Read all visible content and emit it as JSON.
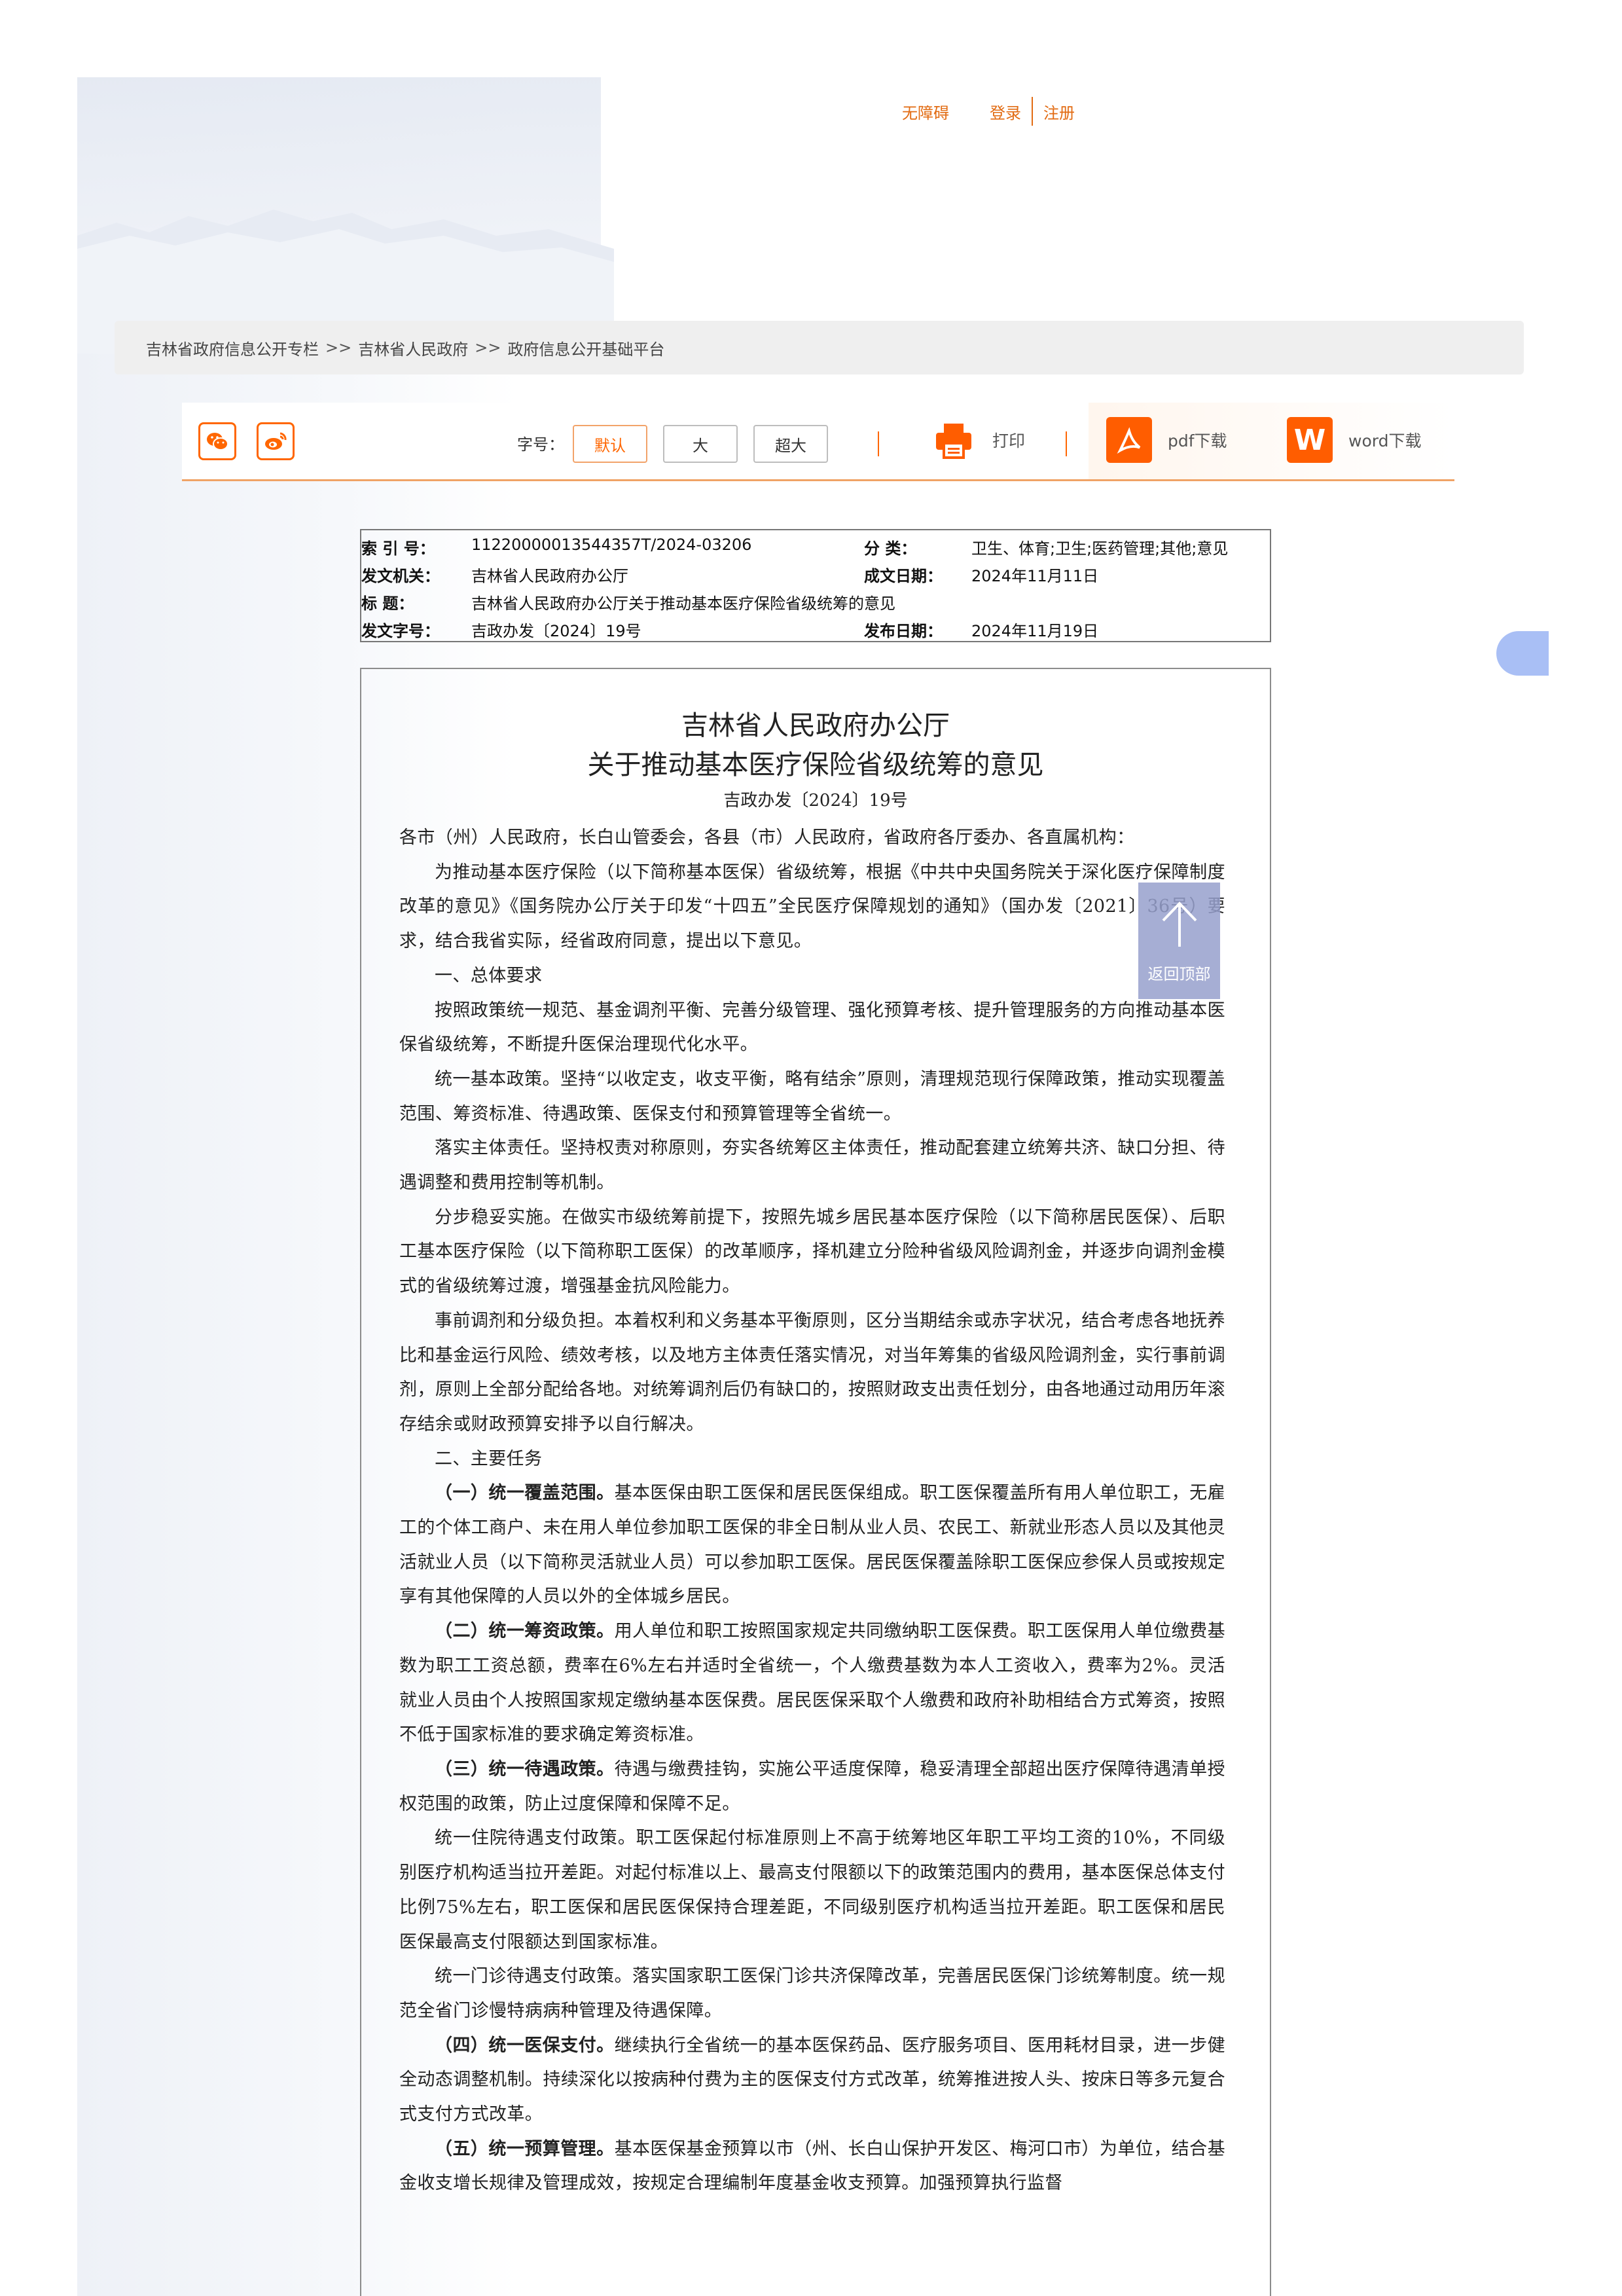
{
  "top_links": {
    "accessibility": "无障碍",
    "login": "登录",
    "register": "注册"
  },
  "breadcrumb": {
    "items": [
      "吉林省政府信息公开专栏",
      "吉林省人民政府",
      "政府信息公开基础平台"
    ],
    "separator": ">>"
  },
  "toolbar": {
    "share_icons": [
      "wechat-icon",
      "weibo-icon"
    ],
    "font_size_label": "字号：",
    "font_sizes": [
      "默认",
      "大",
      "超大"
    ],
    "print_label": "打印",
    "pdf_label": "pdf下载",
    "word_label": "word下载"
  },
  "meta": {
    "index_key": "索 引 号：",
    "index_val": "11220000013544357T/2024-03206",
    "category_key": "分    类：",
    "category_val": "卫生、体育;卫生;医药管理;其他;意见",
    "issuer_key": "发文机关：",
    "issuer_val": "吉林省人民政府办公厅",
    "created_key": "成文日期：",
    "created_val": "2024年11月11日",
    "title_key": "标    题：",
    "title_val": "吉林省人民政府办公厅关于推动基本医疗保险省级统筹的意见",
    "docno_key": "发文字号：",
    "docno_val": "吉政办发〔2024〕19号",
    "published_key": "发布日期：",
    "published_val": "2024年11月19日"
  },
  "document": {
    "title_line1": "吉林省人民政府办公厅",
    "title_line2": "关于推动基本医疗保险省级统筹的意见",
    "doc_no": "吉政办发〔2024〕19号",
    "salutation": "各市（州）人民政府，长白山管委会，各县（市）人民政府，省政府各厅委办、各直属机构：",
    "p1": "为推动基本医疗保险（以下简称基本医保）省级统筹，根据《中共中央国务院关于深化医疗保障制度改革的意见》《国务院办公厅关于印发“十四五”全民医疗保障规划的通知》（国办发〔2021〕36号）要求，结合我省实际，经省政府同意，提出以下意见。",
    "h1": "一、总体要求",
    "p2": "按照政策统一规范、基金调剂平衡、完善分级管理、强化预算考核、提升管理服务的方向推动基本医保省级统筹，不断提升医保治理现代化水平。",
    "p3": "统一基本政策。坚持“以收定支，收支平衡，略有结余”原则，清理规范现行保障政策，推动实现覆盖范围、筹资标准、待遇政策、医保支付和预算管理等全省统一。",
    "p4": "落实主体责任。坚持权责对称原则，夯实各统筹区主体责任，推动配套建立统筹共济、缺口分担、待遇调整和费用控制等机制。",
    "p5": "分步稳妥实施。在做实市级统筹前提下，按照先城乡居民基本医疗保险（以下简称居民医保）、后职工基本医疗保险（以下简称职工医保）的改革顺序，择机建立分险种省级风险调剂金，并逐步向调剂金模式的省级统筹过渡，增强基金抗风险能力。",
    "p6": "事前调剂和分级负担。本着权利和义务基本平衡原则，区分当期结余或赤字状况，结合考虑各地抚养比和基金运行风险、绩效考核，以及地方主体责任落实情况，对当年筹集的省级风险调剂金，实行事前调剂，原则上全部分配给各地。对统筹调剂后仍有缺口的，按照财政支出责任划分，由各地通过动用历年滚存结余或财政预算安排予以自行解决。",
    "h2": "二、主要任务",
    "s1_title": "（一）统一覆盖范围。",
    "s1": "基本医保由职工医保和居民医保组成。职工医保覆盖所有用人单位职工，无雇工的个体工商户、未在用人单位参加职工医保的非全日制从业人员、农民工、新就业形态人员以及其他灵活就业人员（以下简称灵活就业人员）可以参加职工医保。居民医保覆盖除职工医保应参保人员或按规定享有其他保障的人员以外的全体城乡居民。",
    "s2_title": "（二）统一筹资政策。",
    "s2": "用人单位和职工按照国家规定共同缴纳职工医保费。职工医保用人单位缴费基数为职工工资总额，费率在6%左右并适时全省统一，个人缴费基数为本人工资收入，费率为2%。灵活就业人员由个人按照国家规定缴纳基本医保费。居民医保采取个人缴费和政府补助相结合方式筹资，按照不低于国家标准的要求确定筹资标准。",
    "s3_title": "（三）统一待遇政策。",
    "s3": "待遇与缴费挂钩，实施公平适度保障，稳妥清理全部超出医疗保障待遇清单授权范围的政策，防止过度保障和保障不足。",
    "p7": "统一住院待遇支付政策。职工医保起付标准原则上不高于统筹地区年职工平均工资的10%，不同级别医疗机构适当拉开差距。对起付标准以上、最高支付限额以下的政策范围内的费用，基本医保总体支付比例75%左右，职工医保和居民医保保持合理差距，不同级别医疗机构适当拉开差距。职工医保和居民医保最高支付限额达到国家标准。",
    "p8": "统一门诊待遇支付政策。落实国家职工医保门诊共济保障改革，完善居民医保门诊统筹制度。统一规范全省门诊慢特病病种管理及待遇保障。",
    "s4_title": "（四）统一医保支付。",
    "s4": "继续执行全省统一的基本医保药品、医疗服务项目、医用耗材目录，进一步健全动态调整机制。持续深化以按病种付费为主的医保支付方式改革，统筹推进按人头、按床日等多元复合式支付方式改革。",
    "s5_title": "（五）统一预算管理。",
    "s5": "基本医保基金预算以市（州、长白山保护开发区、梅河口市）为单位，结合基金收支增长规律及管理成效，按规定合理编制年度基金收支预算。加强预算执行监督"
  },
  "back_to_top": "返回顶部"
}
